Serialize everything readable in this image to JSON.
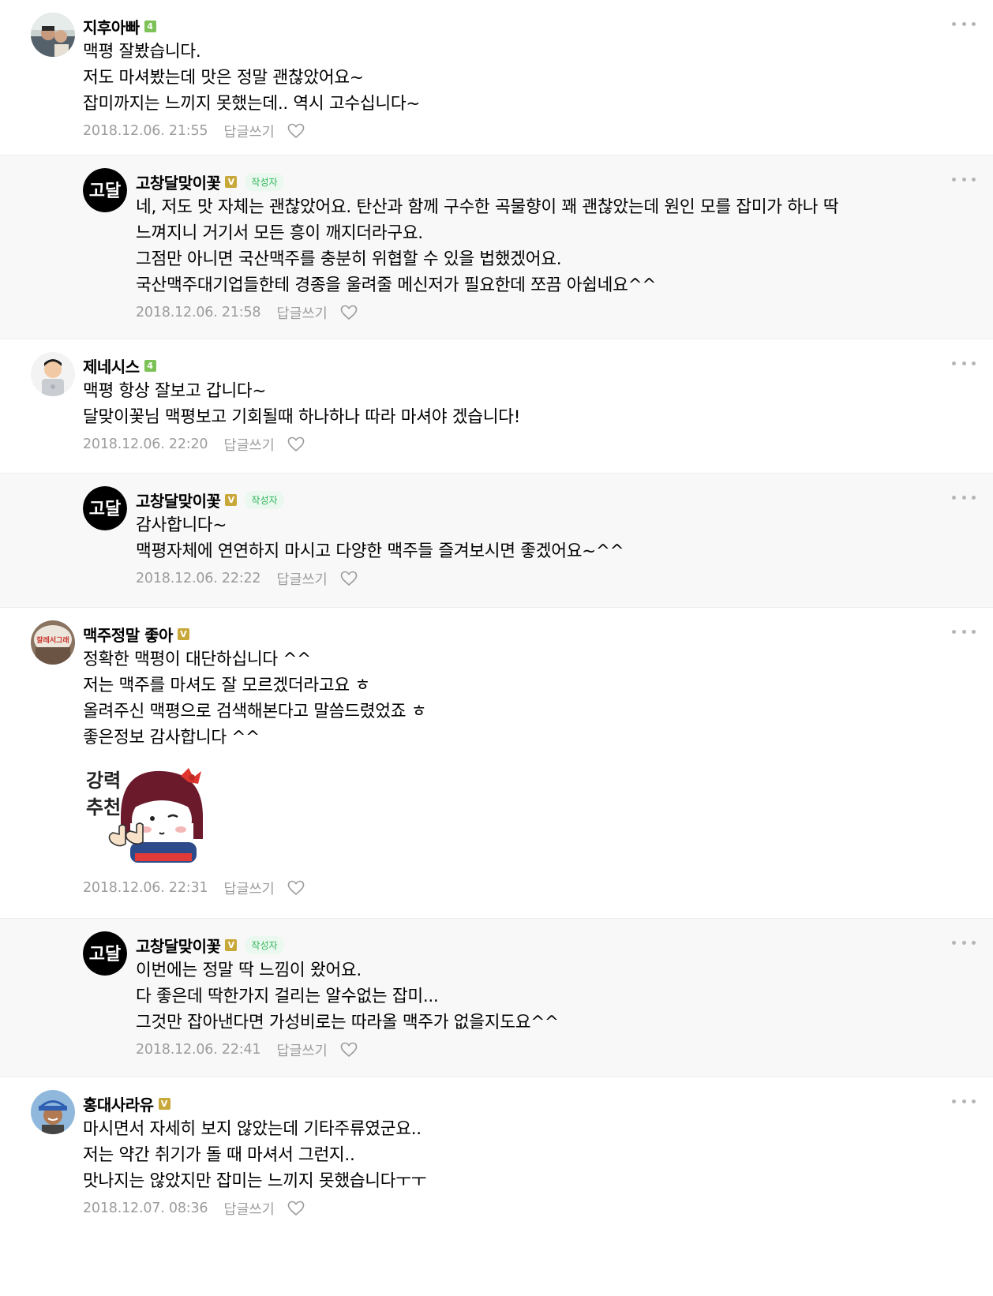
{
  "comments": [
    {
      "nickname": "지후아빠",
      "level": "4",
      "lines": [
        "맥평 잘봤습니다.",
        "저도 마셔봤는데 맛은 정말 괜찮았어요~",
        "잡미까지는 느끼지 못했는데.. 역시 고수십니다~"
      ],
      "date": "2018.12.06. 21:55",
      "reply_label": "답글쓰기"
    },
    {
      "nickname": "고창달맞이꽃",
      "level": "V",
      "author_tag": "작성자",
      "avatar_text": "고달",
      "lines": [
        "네, 저도 맛 자체는 괜찮았어요. 탄산과 함께 구수한 곡물향이 꽤 괜찮았는데 원인 모를 잡미가 하나 딱",
        "느껴지니 거기서 모든 흥이 깨지더라구요.",
        "그점만 아니면 국산맥주를 충분히 위협할 수 있을 법했겠어요.",
        "국산맥주대기업들한테 경종을 울려줄 메신저가 필요한데 쪼끔 아쉽네요^^"
      ],
      "date": "2018.12.06. 21:58",
      "reply_label": "답글쓰기"
    },
    {
      "nickname": "제네시스",
      "level": "4",
      "lines": [
        "맥평 항상 잘보고 갑니다~",
        "달맞이꽃님 맥평보고 기회될때 하나하나 따라 마셔야 겠습니다!"
      ],
      "date": "2018.12.06. 22:20",
      "reply_label": "답글쓰기"
    },
    {
      "nickname": "고창달맞이꽃",
      "level": "V",
      "author_tag": "작성자",
      "avatar_text": "고달",
      "lines": [
        "감사합니다~",
        "맥평자체에 연연하지 마시고 다양한 맥주들 즐겨보시면 좋겠어요~^^"
      ],
      "date": "2018.12.06. 22:22",
      "reply_label": "답글쓰기"
    },
    {
      "nickname": "맥주정말 좋아",
      "level": "V",
      "avatar_text": "잘레서그래",
      "lines": [
        "정확한 맥평이 대단하십니다 ^^",
        "저는 맥주를 마셔도 잘 모르겠더라고요 ㅎ",
        "올려주신 맥평으로 검색해본다고 말씀드렸었죠 ㅎ",
        "좋은정보 감사합니다 ^^"
      ],
      "sticker_text_1": "강력",
      "sticker_text_2": "추천",
      "date": "2018.12.06. 22:31",
      "reply_label": "답글쓰기"
    },
    {
      "nickname": "고창달맞이꽃",
      "level": "V",
      "author_tag": "작성자",
      "avatar_text": "고달",
      "lines": [
        "이번에는 정말 딱 느낌이 왔어요.",
        "다 좋은데 딱한가지 걸리는 알수없는 잡미...",
        "그것만 잡아낸다면 가성비로는 따라올 맥주가 없을지도요^^"
      ],
      "date": "2018.12.06. 22:41",
      "reply_label": "답글쓰기"
    },
    {
      "nickname": "홍대사라유",
      "level": "V",
      "lines": [
        "마시면서 자세히 보지 않았는데 기타주류였군요..",
        "저는 약간 취기가 돌 때 마셔서 그런지..",
        "맛나지는 않았지만 잡미는 느끼지 못했습니다ㅜㅜ"
      ],
      "date": "2018.12.07. 08:36",
      "reply_label": "답글쓰기"
    }
  ],
  "colors": {
    "level_green": "#7cc257",
    "level_gold": "#c9a83a",
    "author_tag_bg": "#eaf8ef",
    "author_tag_text": "#33b65a",
    "reply_bg": "#f8f8f8",
    "meta_gray": "#9c9c9c"
  }
}
